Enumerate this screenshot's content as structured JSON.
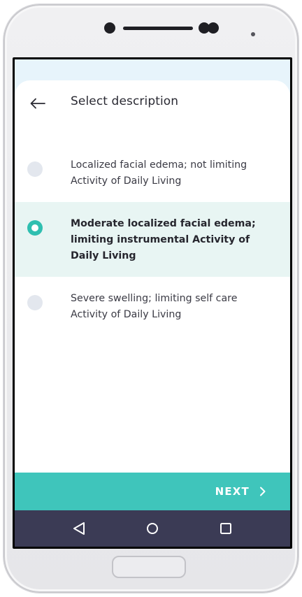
{
  "header": {
    "title": "Select description",
    "back_icon": "arrow-left-icon"
  },
  "options": [
    {
      "label": "Localized facial edema; not limiting Activity of Daily Living",
      "selected": false
    },
    {
      "label": "Moderate localized facial edema; limiting instrumental Activity of Daily Living",
      "selected": true
    },
    {
      "label": "Severe swelling; limiting self care Activity of Daily Living",
      "selected": false
    }
  ],
  "footer": {
    "next_label": "NEXT",
    "next_icon": "chevron-right-icon"
  },
  "navbar": {
    "back_icon": "triangle-back-icon",
    "home_icon": "circle-home-icon",
    "recents_icon": "square-recents-icon"
  },
  "colors": {
    "accent": "#3fc5bb",
    "radio_selected": "#2fbfb0",
    "selected_row_bg": "#e8f5f3",
    "navbar_bg": "#3b3b55",
    "top_bg": "#e7f4fb"
  }
}
